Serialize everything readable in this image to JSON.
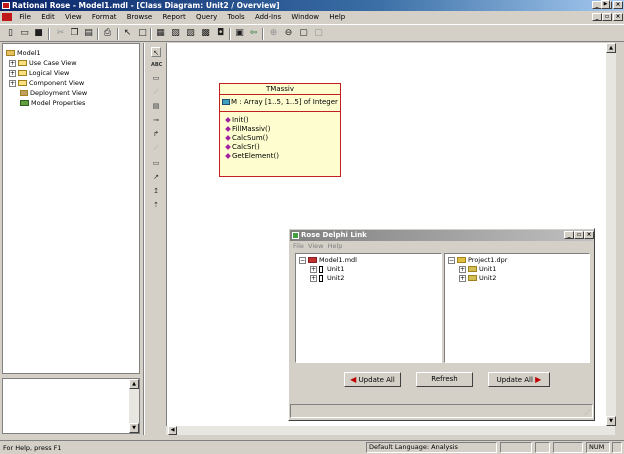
{
  "app": {
    "title": "Rational Rose - Model1.mdl - [Class Diagram: Unit2 / Overview]"
  },
  "menubar": {
    "items": [
      "File",
      "Edit",
      "View",
      "Format",
      "Browse",
      "Report",
      "Query",
      "Tools",
      "Add-Ins",
      "Window",
      "Help"
    ]
  },
  "browser": {
    "root": "Model1",
    "items": [
      {
        "label": "Use Case View"
      },
      {
        "label": "Logical View"
      },
      {
        "label": "Component View"
      },
      {
        "label": "Deployment View"
      },
      {
        "label": "Model Properties"
      }
    ]
  },
  "palette": {
    "text_tool": "ABC"
  },
  "class": {
    "name": "TMassiv",
    "attribute": "M : Array [1..5, 1..5] of Integer",
    "operations": [
      "Init()",
      "FillMassiv()",
      "CalcSum()",
      "CalcSr()",
      "GetElement()"
    ]
  },
  "delphi": {
    "title": "Rose Delphi Link",
    "menu": [
      "File",
      "View",
      "Help"
    ],
    "left_tree": {
      "root": "Model1.mdl",
      "children": [
        "Unit1",
        "Unit2"
      ]
    },
    "right_tree": {
      "root": "Project1.dpr",
      "children": [
        "Unit1",
        "Unit2"
      ]
    },
    "buttons": {
      "update_left": "Update All",
      "refresh": "Refresh",
      "update_right": "Update All"
    }
  },
  "status": {
    "help": "For Help, press F1",
    "language": "Default Language: Analysis",
    "num": "NUM"
  },
  "colors": {
    "titlebar_active": "#0a246a",
    "class_border": "#c02020",
    "class_fill": "#fdfdd0",
    "arrow_red": "#c00000"
  }
}
